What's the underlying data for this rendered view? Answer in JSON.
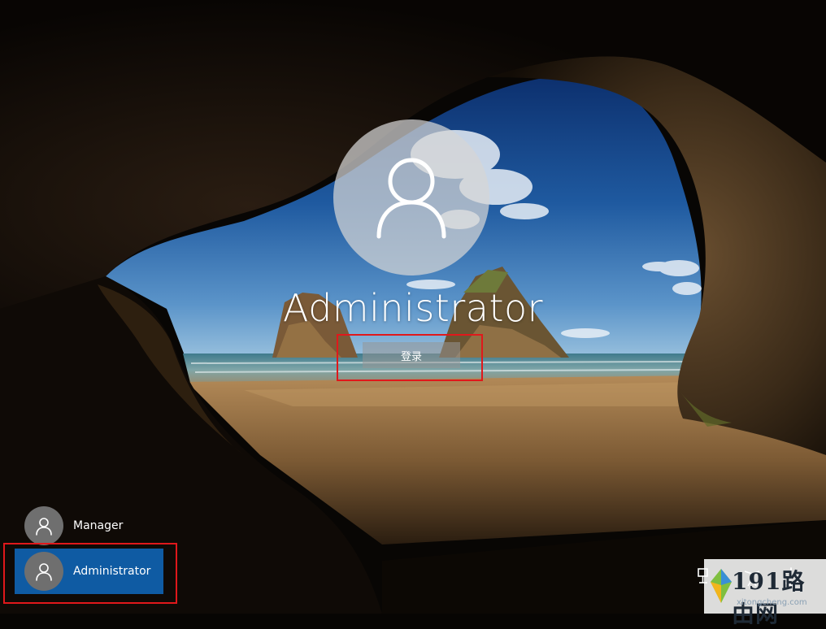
{
  "login_screen": {
    "user_name": "Administrator",
    "sign_in_label": "登录",
    "avatar_icon": "user-icon"
  },
  "user_list": [
    {
      "name": "Manager",
      "icon": "user-icon",
      "selected": false
    },
    {
      "name": "Administrator",
      "icon": "user-icon",
      "selected": true
    }
  ],
  "system_icons": [
    "network-icon",
    "ease-of-access-icon",
    "power-icon"
  ],
  "watermark": {
    "brand": "191路由网",
    "url": "xitongcheng.com"
  },
  "colors": {
    "selected_bg": "#0f5ba3",
    "highlight_box": "#e0181b"
  }
}
